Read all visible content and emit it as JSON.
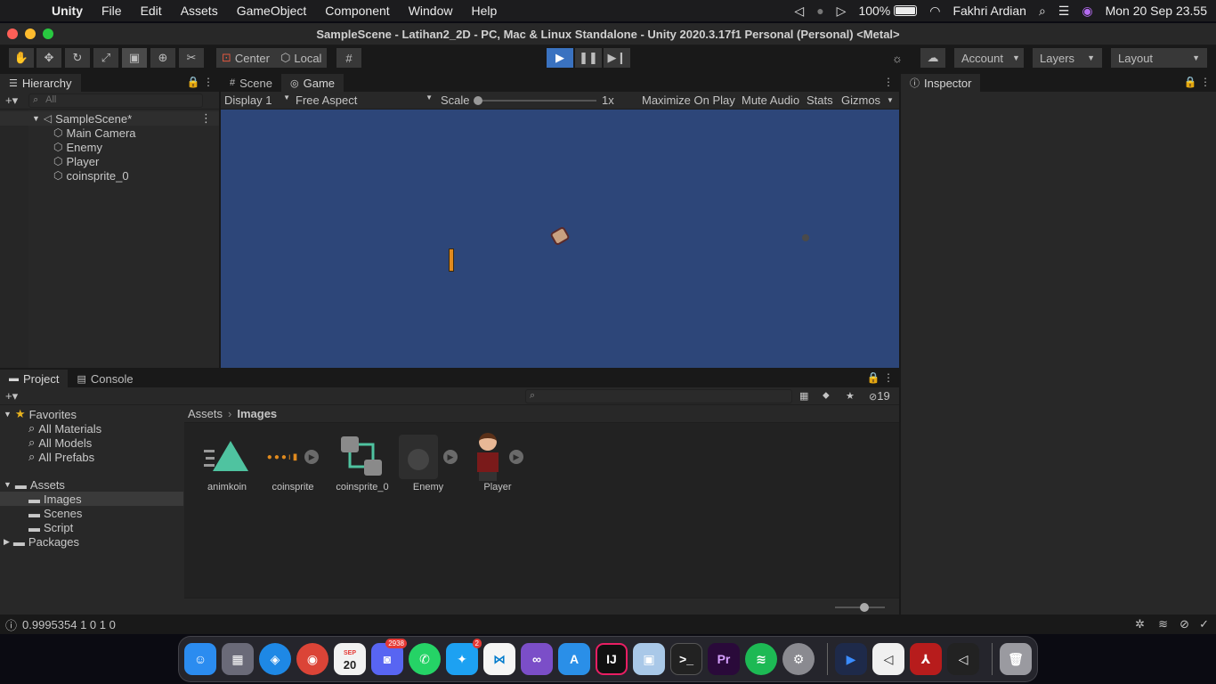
{
  "menubar": {
    "app_name": "Unity",
    "menus": [
      "File",
      "Edit",
      "Assets",
      "GameObject",
      "Component",
      "Window",
      "Help"
    ],
    "battery": "100%",
    "user": "Fakhri Ardian",
    "clock": "Mon 20 Sep  23.55"
  },
  "window": {
    "title": "SampleScene - Latihan2_2D - PC, Mac & Linux Standalone - Unity 2020.3.17f1 Personal (Personal) <Metal>"
  },
  "toolbar": {
    "pivot_label": "Center",
    "space_label": "Local",
    "account_label": "Account",
    "layers_label": "Layers",
    "layout_label": "Layout"
  },
  "hierarchy": {
    "tab_label": "Hierarchy",
    "search_placeholder": "All",
    "scene_name": "SampleScene*",
    "objects": [
      "Main Camera",
      "Enemy",
      "Player",
      "coinsprite_0"
    ]
  },
  "game": {
    "tabs": [
      "Scene",
      "Game"
    ],
    "display": "Display 1",
    "aspect": "Free Aspect",
    "scale_label": "Scale",
    "scale_value": "1x",
    "toggles": [
      "Maximize On Play",
      "Mute Audio",
      "Stats",
      "Gizmos"
    ]
  },
  "inspector": {
    "tab_label": "Inspector"
  },
  "project": {
    "tabs": [
      "Project",
      "Console"
    ],
    "hidden_count": "19",
    "favorites_label": "Favorites",
    "favorites": [
      "All Materials",
      "All Models",
      "All Prefabs"
    ],
    "assets_label": "Assets",
    "asset_folders": [
      "Images",
      "Scenes",
      "Script"
    ],
    "packages_label": "Packages",
    "breadcrumb": [
      "Assets",
      "Images"
    ],
    "items": [
      "animkoin",
      "coinsprite",
      "coinsprite_0",
      "Enemy",
      "Player"
    ]
  },
  "status": {
    "text": "0.9995354 1 0 1 0"
  },
  "dock": {
    "calendar_month": "SEP",
    "calendar_day": "20",
    "discord_badge": "2938",
    "twitter_badge": "2"
  }
}
